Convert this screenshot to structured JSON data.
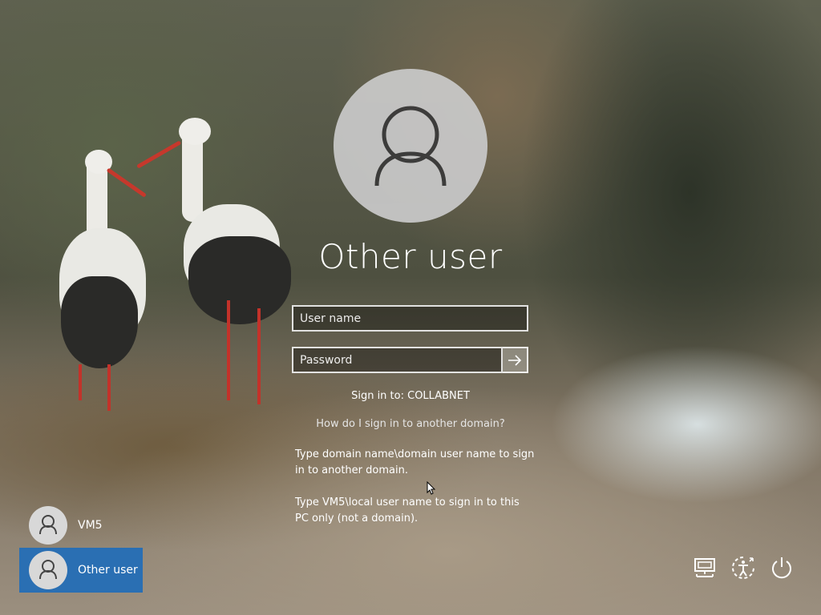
{
  "login": {
    "title": "Other user",
    "username_placeholder": "User name",
    "password_placeholder": "Password",
    "sign_in_to": "Sign in to: COLLABNET",
    "domain_help_link": "How do I sign in to another domain?",
    "help_line_1": "Type domain name\\domain user name to sign in to another domain.",
    "help_line_2": "Type VM5\\local user name to sign in to this PC only (not a domain)."
  },
  "users": [
    {
      "name": "VM5",
      "selected": false
    },
    {
      "name": "Other user",
      "selected": true
    }
  ],
  "system_icons": [
    "network-icon",
    "ease-of-access-icon",
    "power-icon"
  ],
  "colors": {
    "selected_tile": "#2a6fb3"
  }
}
